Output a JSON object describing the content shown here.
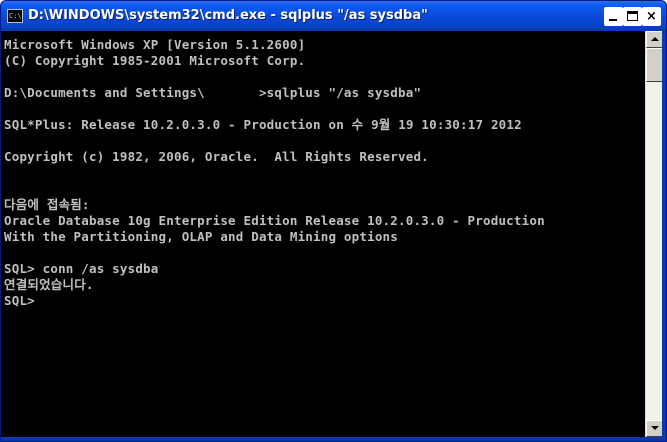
{
  "window": {
    "title": "D:\\WINDOWS\\system32\\cmd.exe - sqlplus \"/as sysdba\"",
    "app_icon_text": "C:\\",
    "controls": {
      "minimize": "minimize",
      "maximize": "maximize",
      "close": "×"
    }
  },
  "console": {
    "lines": [
      "Microsoft Windows XP [Version 5.1.2600]",
      "(C) Copyright 1985-2001 Microsoft Corp.",
      "",
      "D:\\Documents and Settings\\       >sqlplus \"/as sysdba\"",
      "",
      "SQL*Plus: Release 10.2.0.3.0 - Production on 수 9월 19 10:30:17 2012",
      "",
      "Copyright (c) 1982, 2006, Oracle.  All Rights Reserved.",
      "",
      "",
      "다음에 접속됨:",
      "Oracle Database 10g Enterprise Edition Release 10.2.0.3.0 - Production",
      "With the Partitioning, OLAP and Data Mining options",
      "",
      "SQL> conn /as sysdba",
      "연결되었습니다.",
      "SQL>"
    ]
  },
  "colors": {
    "titlebar": "#0a5bf0",
    "console_bg": "#000000",
    "console_fg": "#c0c0c0"
  }
}
